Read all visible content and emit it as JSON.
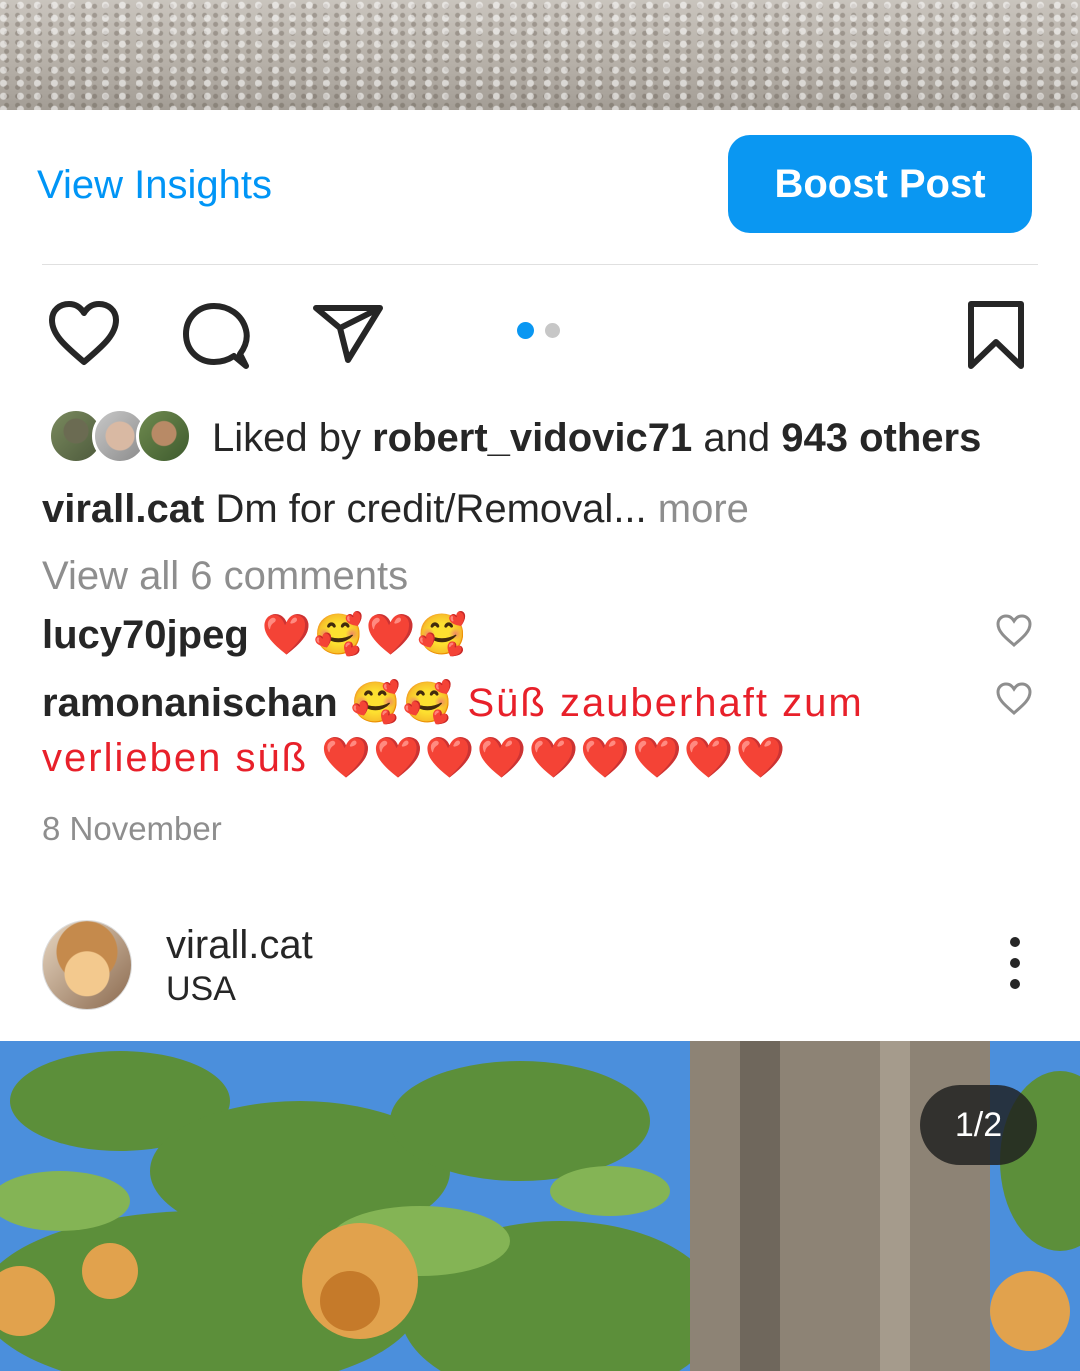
{
  "insights": {
    "view_label": "View Insights",
    "boost_label": "Boost Post"
  },
  "actions": {
    "icons": [
      "heart-icon",
      "comment-icon",
      "share-icon",
      "bookmark-icon"
    ],
    "carousel": {
      "total": 2,
      "current": 1
    }
  },
  "likes": {
    "prefix": "Liked by ",
    "user": "robert_vidovic71",
    "middle": " and ",
    "others": "943 others"
  },
  "caption": {
    "username": "virall.cat",
    "text": " Dm for credit/Removal",
    "ellipsis": "... ",
    "more": "more"
  },
  "comments": {
    "view_all": "View all 6 comments",
    "items": [
      {
        "username": "lucy70jpeg",
        "text": " ❤️🥰❤️🥰"
      },
      {
        "username": "ramonanischan",
        "text": " 🥰🥰 Süß zauberhaft zum verlieben süß ❤️❤️❤️❤️❤️❤️❤️❤️❤️"
      }
    ]
  },
  "date": "8 November",
  "next_post": {
    "username": "virall.cat",
    "location": "USA",
    "counter": "1/2"
  },
  "colors": {
    "accent": "#0095f6",
    "button": "#0a97f2",
    "muted": "#8e8e8e"
  }
}
